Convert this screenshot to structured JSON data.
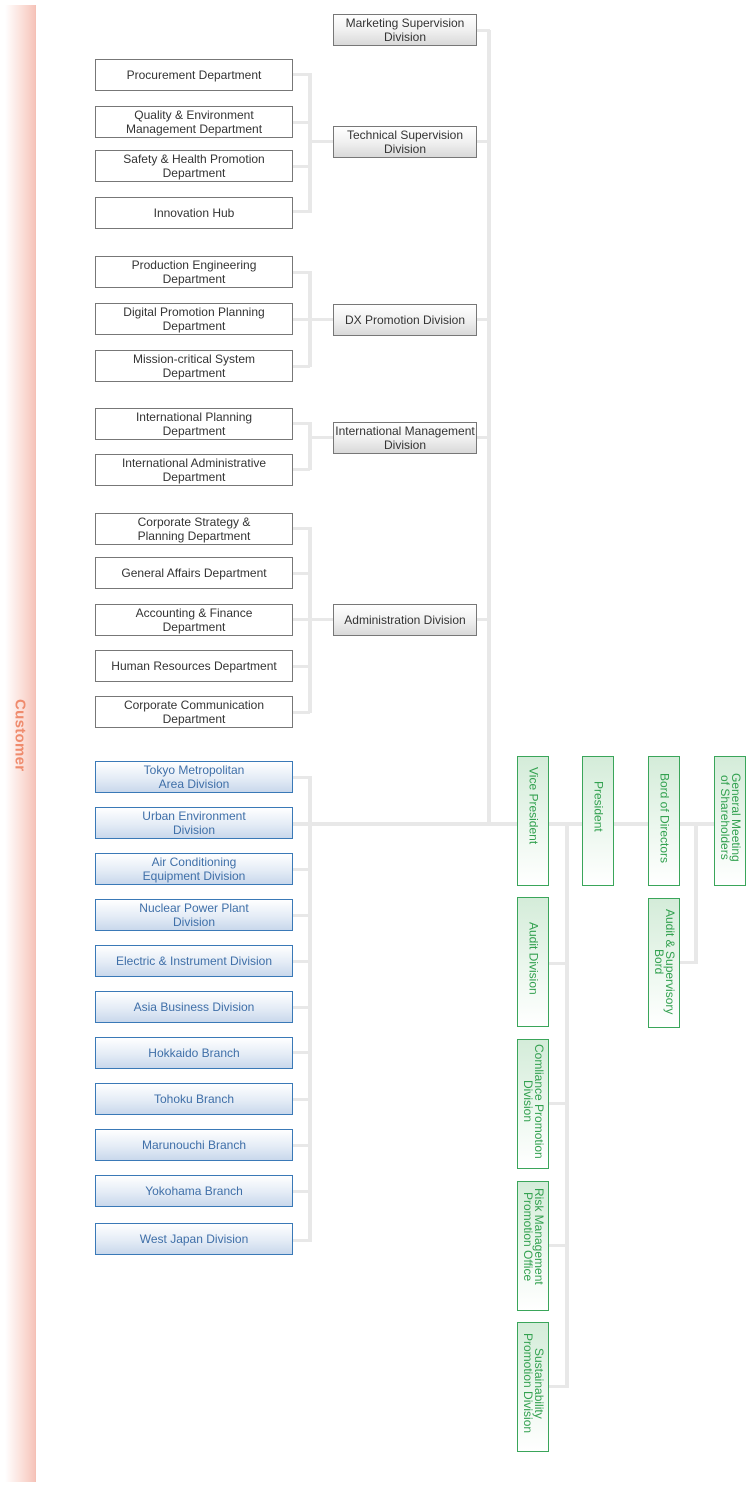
{
  "customer_label": "Customer",
  "colors": {
    "customer": "#ef8b6d",
    "connector": "#e8e8e8",
    "department_border": "#777777",
    "business_border": "#3a79b7",
    "business_text": "#3f6fa8",
    "executive_border": "#3aa55a",
    "executive_text": "#33a150"
  },
  "divisions": [
    {
      "name": "Marketing Supervision\nDivision",
      "departments": []
    },
    {
      "name": "Technical Supervision\nDivision",
      "departments": [
        "Procurement Department",
        "Quality & Environment\nManagement Department",
        "Safety & Health Promotion\nDepartment",
        "Innovation Hub"
      ]
    },
    {
      "name": "DX Promotion Division",
      "departments": [
        "Production Engineering\nDepartment",
        "Digital Promotion Planning\nDepartment",
        "Mission-critical System\nDepartment"
      ]
    },
    {
      "name": "International Management\nDivision",
      "departments": [
        "International Planning\nDepartment",
        "International Administrative\nDepartment"
      ]
    },
    {
      "name": "Administration Division",
      "departments": [
        "Corporate Strategy &\nPlanning Department",
        "General Affairs Department",
        "Accounting & Finance\nDepartment",
        "Human Resources Department",
        "Corporate Communication\nDepartment"
      ]
    }
  ],
  "business_units": [
    "Tokyo Metropolitan\nArea Division",
    "Urban Environment\nDivision",
    "Air Conditioning\nEquipment Division",
    "Nuclear Power Plant\nDivision",
    "Electric & Instrument Division",
    "Asia Business Division",
    "Hokkaido Branch",
    "Tohoku Branch",
    "Marunouchi Branch",
    "Yokohama Branch",
    "West Japan Division"
  ],
  "executives": {
    "vice_president": "Vice President",
    "president": "President",
    "board_of_directors": "Bord of Directors",
    "general_meeting": "General Meeting\nof Shareholders",
    "audit_supervisory_board": "Audit & Supervisory\nBord"
  },
  "president_offices": [
    "Audit Division",
    "Comliance Promotion\nDivision",
    "Risk Management\nPromotion Office",
    "Sustainability\nPromotion Division"
  ]
}
